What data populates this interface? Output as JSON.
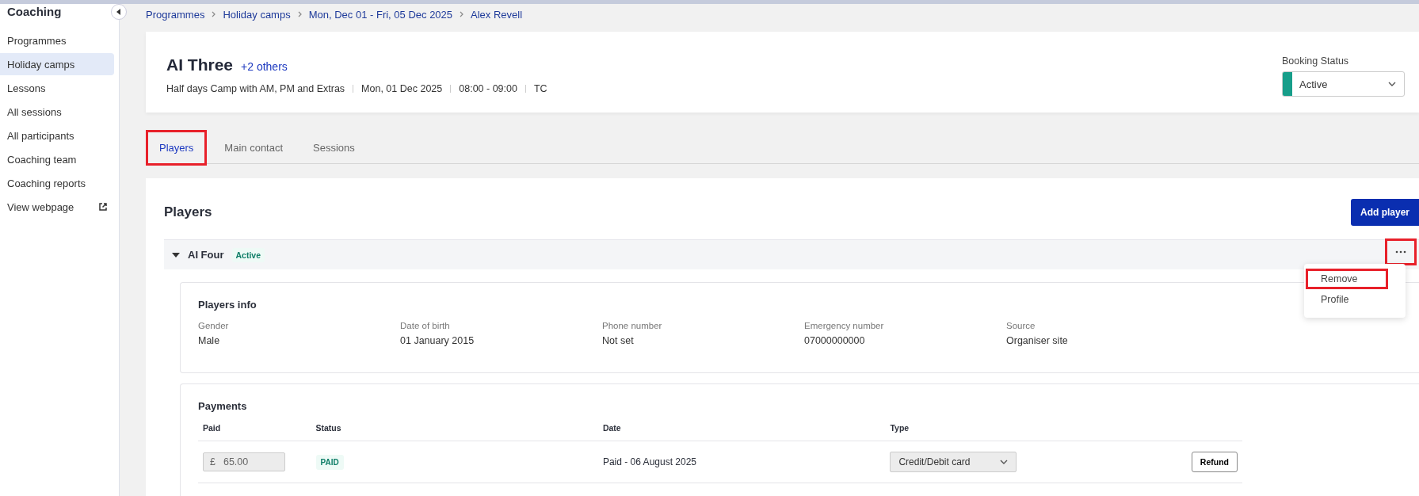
{
  "sidebar": {
    "title": "Coaching",
    "items": [
      {
        "label": "Programmes",
        "selected": false,
        "kind": "link"
      },
      {
        "label": "Holiday camps",
        "selected": true,
        "kind": "link"
      },
      {
        "label": "Lessons",
        "selected": false,
        "kind": "link"
      },
      {
        "label": "All sessions",
        "selected": false,
        "kind": "link"
      },
      {
        "label": "All participants",
        "selected": false,
        "kind": "link"
      },
      {
        "label": "Coaching team",
        "selected": false,
        "kind": "link"
      },
      {
        "label": "Coaching reports",
        "selected": false,
        "kind": "link"
      },
      {
        "label": "View webpage",
        "selected": false,
        "kind": "external"
      }
    ]
  },
  "breadcrumb": [
    "Programmes",
    "Holiday camps",
    "Mon, Dec 01 - Fri, 05 Dec 2025",
    "Alex Revell"
  ],
  "header": {
    "title": "AI Three",
    "others": "+2 others",
    "details": [
      "Half days Camp with AM, PM and Extras",
      "Mon, 01 Dec 2025",
      "08:00 - 09:00",
      "TC"
    ],
    "booking_status": {
      "label": "Booking Status",
      "value": "Active",
      "color": "#179e8a"
    }
  },
  "tabs": [
    {
      "label": "Players",
      "selected": true,
      "highlighted": true
    },
    {
      "label": "Main contact",
      "selected": false,
      "highlighted": false
    },
    {
      "label": "Sessions",
      "selected": false,
      "highlighted": false
    }
  ],
  "players": {
    "title": "Players",
    "add_button": "Add player",
    "player": {
      "name": "AI Four",
      "status": "Active",
      "expanded": true,
      "more_highlighted": true,
      "menu": [
        {
          "label": "Remove",
          "highlighted": true
        },
        {
          "label": "Profile",
          "highlighted": false
        }
      ],
      "info": {
        "title": "Players info",
        "fields": [
          {
            "label": "Gender",
            "value": "Male"
          },
          {
            "label": "Date of birth",
            "value": "01 January 2015"
          },
          {
            "label": "Phone number",
            "value": "Not set"
          },
          {
            "label": "Emergency number",
            "value": "07000000000"
          },
          {
            "label": "Source",
            "value": "Organiser site"
          }
        ]
      },
      "payments": {
        "title": "Payments",
        "columns": [
          "Paid",
          "Status",
          "Date",
          "Type"
        ],
        "rows": [
          {
            "currency": "£",
            "amount": "65.00",
            "status": "PAID",
            "date": "Paid - 06 August 2025",
            "type": "Credit/Debit card",
            "action": "Refund"
          }
        ]
      }
    }
  }
}
